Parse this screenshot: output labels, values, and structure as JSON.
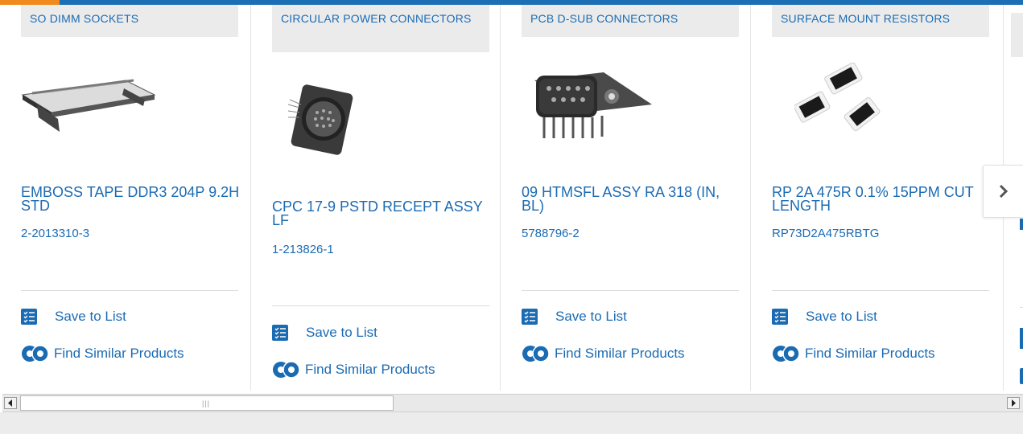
{
  "cards": [
    {
      "category": "SO DIMM SOCKETS",
      "title": "EMBOSS TAPE DDR3 204P 9.2H STD",
      "part_number": "2-2013310-3",
      "save_label": "Save to List",
      "similar_label": "Find Similar Products",
      "image_icon": "so-dimm-socket-image"
    },
    {
      "category": "CIRCULAR POWER CONNECTORS",
      "title": "CPC 17-9 PSTD RECEPT ASSY LF",
      "part_number": "1-213826-1",
      "save_label": "Save to List",
      "similar_label": "Find Similar Products",
      "image_icon": "circular-connector-image"
    },
    {
      "category": "PCB D-SUB CONNECTORS",
      "title": "09 HTMSFL ASSY RA 318 (IN, BL)",
      "part_number": "5788796-2",
      "save_label": "Save to List",
      "similar_label": "Find Similar Products",
      "image_icon": "d-sub-connector-image"
    },
    {
      "category": "SURFACE MOUNT RESISTORS",
      "title": "RP 2A 475R 0.1% 15PPM CUT LENGTH",
      "part_number": "RP73D2A475RBTG",
      "save_label": "Save to List",
      "similar_label": "Find Similar Products",
      "image_icon": "smd-resistor-image"
    }
  ],
  "carousel": {
    "next_icon": "chevron-right-icon"
  },
  "scrollbar": {
    "grip": "|||"
  },
  "colors": {
    "link": "#1b6bb3",
    "brand_bar": "#1c6fb4",
    "accent": "#f08a1c",
    "category_bg": "#ebebeb"
  }
}
